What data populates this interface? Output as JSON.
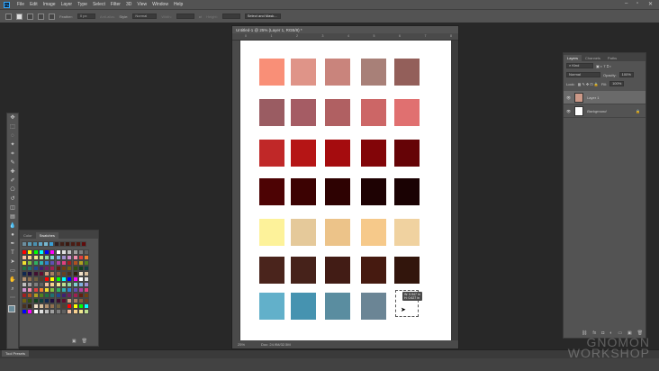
{
  "menu": {
    "logo": "Ps",
    "items": [
      "File",
      "Edit",
      "Image",
      "Layer",
      "Type",
      "Select",
      "Filter",
      "3D",
      "View",
      "Window",
      "Help"
    ]
  },
  "options": {
    "feather_label": "Feather:",
    "feather_value": "0 px",
    "antialias": "Anti-alias",
    "style_label": "Style:",
    "style_value": "Normal",
    "width_label": "Width:",
    "height_label": "Height:",
    "select_mask": "Select and Mask..."
  },
  "document": {
    "title": "Untitled-1 @ 25% (Layer 1, RGB/8) *",
    "ruler": [
      "0",
      "1",
      "2",
      "3",
      "4",
      "5",
      "6",
      "7",
      "8"
    ],
    "zoom": "25%",
    "doc_size": "Doc: 24.9M/32.5M",
    "swatches": [
      [
        "#f98f77",
        "#df9488",
        "#c9847c",
        "#a88078",
        "#935f5a"
      ],
      [
        "#9a5c62",
        "#a55c64",
        "#b06062",
        "#cc6666",
        "#e07070"
      ],
      [
        "#c02828",
        "#b51515",
        "#a50c0e",
        "#820508",
        "#650306"
      ],
      [
        "#4d0304",
        "#3c0202",
        "#2e0202",
        "#1e0203",
        "#1a0203"
      ],
      [
        "#fdf29a",
        "#e5c99a",
        "#ecc389",
        "#f6c98a",
        "#f0d2a0"
      ],
      [
        "#4a241c",
        "#46221a",
        "#421c15",
        "#461a10",
        "#32150c"
      ],
      [
        "#62b0ca",
        "#4693b0",
        "#5a8da0",
        "#6b8595",
        null
      ]
    ],
    "tooltip_w": "W: 0.947 in",
    "tooltip_h": "H: 0.627 in"
  },
  "swatches_panel": {
    "tabs": [
      "Color",
      "Swatches"
    ],
    "recent": [
      "#6c8fa0",
      "#5b9bb5",
      "#4a90b0",
      "#62a8c8",
      "#78b8d0",
      "#3aa0d8",
      "#302020",
      "#402018",
      "#3a1810",
      "#4a1c14",
      "#501a10",
      "#600c0c"
    ],
    "palette": [
      "#ff0000",
      "#ffff00",
      "#00ff00",
      "#00ffff",
      "#0000ff",
      "#ff00ff",
      "#ffffff",
      "#e0e0e0",
      "#c0c0c0",
      "#a0a0a0",
      "#808080",
      "#606060",
      "#f4c0a0",
      "#f8d090",
      "#f0e890",
      "#c0e090",
      "#90d8a0",
      "#80d0d0",
      "#80b0e0",
      "#a090d0",
      "#d090d0",
      "#f090b0",
      "#e04040",
      "#f08030",
      "#f0e030",
      "#80c040",
      "#30b060",
      "#30b0b0",
      "#3080d0",
      "#6050b0",
      "#b040a0",
      "#e04080",
      "#a02020",
      "#b05020",
      "#b0a020",
      "#508020",
      "#207040",
      "#207070",
      "#204890",
      "#402070",
      "#702060",
      "#a02050",
      "#602010",
      "#704010",
      "#706010",
      "#305010",
      "#104020",
      "#104040",
      "#102850",
      "#201040",
      "#401030",
      "#601030",
      "#c8a080",
      "#a88060",
      "#886040",
      "#684020",
      "#483020",
      "#302010",
      "#f0e0c8",
      "#d8c0a0",
      "#b09070",
      "#907050",
      "#706040",
      "#504030"
    ]
  },
  "layers": {
    "tabs": [
      "Layers",
      "Channels",
      "Paths"
    ],
    "kind": "Kind",
    "blend": "Normal",
    "opacity_label": "Opacity:",
    "opacity": "100%",
    "lock_label": "Lock:",
    "fill_label": "Fill:",
    "fill": "100%",
    "items": [
      {
        "name": "Layer 1",
        "selected": true
      },
      {
        "name": "Background",
        "selected": false
      }
    ]
  },
  "tool_presets": "Tool Presets",
  "watermark": [
    "the GNOMON",
    "WORKSHOP"
  ]
}
